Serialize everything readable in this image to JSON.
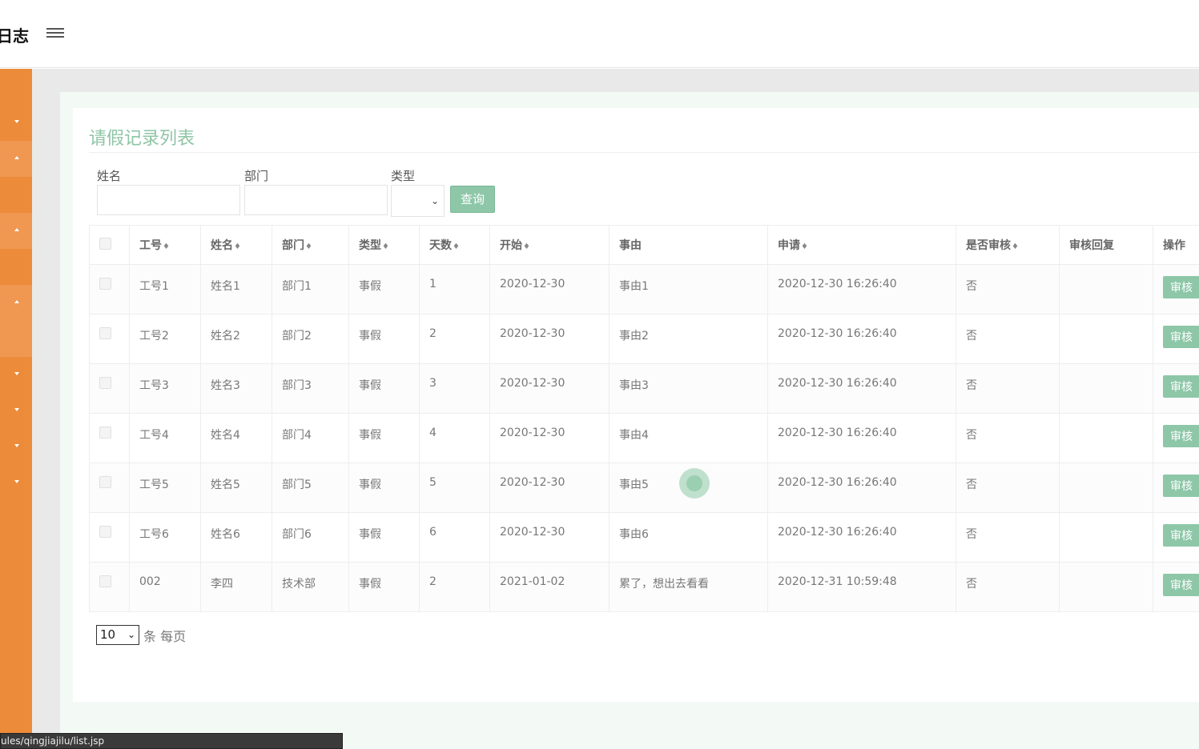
{
  "header": {
    "brand": "日志",
    "menu_icon": "hamburger-icon"
  },
  "sidebar": {
    "items": [
      {
        "arrow": "down"
      },
      {
        "arrow": "up"
      },
      {
        "arrow": "up"
      },
      {
        "arrow": "up"
      },
      {
        "arrow": "down"
      },
      {
        "arrow": "down"
      },
      {
        "arrow": "down"
      },
      {
        "arrow": "down"
      }
    ]
  },
  "page": {
    "title": "请假记录列表"
  },
  "filters": {
    "name_label": "姓名",
    "name_value": "",
    "dept_label": "部门",
    "dept_value": "",
    "type_label": "类型",
    "type_value": "",
    "query_button": "查询"
  },
  "table": {
    "headers": [
      "工号",
      "姓名",
      "部门",
      "类型",
      "天数",
      "开始",
      "事由",
      "申请",
      "是否审核",
      "审核回复",
      "操作"
    ],
    "sortable": [
      true,
      true,
      true,
      true,
      true,
      true,
      false,
      true,
      true,
      false,
      false
    ],
    "action_label": "审核",
    "rows": [
      {
        "id": "工号1",
        "name": "姓名1",
        "dept": "部门1",
        "type": "事假",
        "days": "1",
        "start": "2020-12-30",
        "reason": "事由1",
        "apply": "2020-12-30 16:26:40",
        "audited": "否",
        "reply": ""
      },
      {
        "id": "工号2",
        "name": "姓名2",
        "dept": "部门2",
        "type": "事假",
        "days": "2",
        "start": "2020-12-30",
        "reason": "事由2",
        "apply": "2020-12-30 16:26:40",
        "audited": "否",
        "reply": ""
      },
      {
        "id": "工号3",
        "name": "姓名3",
        "dept": "部门3",
        "type": "事假",
        "days": "3",
        "start": "2020-12-30",
        "reason": "事由3",
        "apply": "2020-12-30 16:26:40",
        "audited": "否",
        "reply": ""
      },
      {
        "id": "工号4",
        "name": "姓名4",
        "dept": "部门4",
        "type": "事假",
        "days": "4",
        "start": "2020-12-30",
        "reason": "事由4",
        "apply": "2020-12-30 16:26:40",
        "audited": "否",
        "reply": ""
      },
      {
        "id": "工号5",
        "name": "姓名5",
        "dept": "部门5",
        "type": "事假",
        "days": "5",
        "start": "2020-12-30",
        "reason": "事由5",
        "apply": "2020-12-30 16:26:40",
        "audited": "否",
        "reply": ""
      },
      {
        "id": "工号6",
        "name": "姓名6",
        "dept": "部门6",
        "type": "事假",
        "days": "6",
        "start": "2020-12-30",
        "reason": "事由6",
        "apply": "2020-12-30 16:26:40",
        "audited": "否",
        "reply": ""
      },
      {
        "id": "002",
        "name": "李四",
        "dept": "技术部",
        "type": "事假",
        "days": "2",
        "start": "2021-01-02",
        "reason": "累了，想出去看看",
        "apply": "2020-12-31 10:59:48",
        "audited": "否",
        "reply": ""
      }
    ]
  },
  "pager": {
    "page_size": "10",
    "suffix": "条 每页"
  },
  "status": {
    "url": "ules/qingjiajilu/list.jsp"
  },
  "colors": {
    "sidebar": "#ec8b3a",
    "accent": "#8dc7a8",
    "title": "#8fc5a6"
  }
}
